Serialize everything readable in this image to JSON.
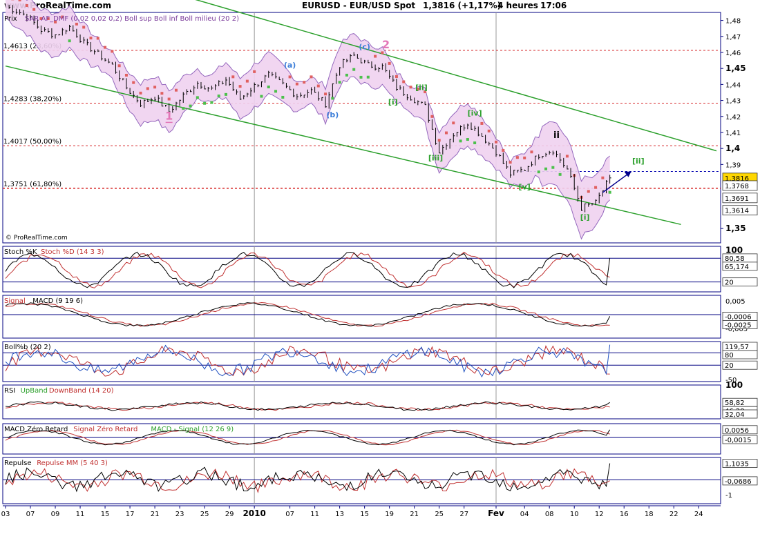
{
  "header": {
    "site": "www.ProRealTime.com",
    "symbol": "EURUSD - EUR/USD Spot",
    "price": "1,3816 (+1,17%)",
    "timeframe": "4 heures",
    "time": "17:06"
  },
  "watermark": "© ProRealTime.com",
  "chart_data": {
    "type": "line",
    "price_panel": {
      "label": "Prix",
      "indicators": "SAR AF_DMF (0,02 0,02 0,2)   Boll sup Boll inf Boll milieu (20 2)",
      "y_ticks": [
        "1,48",
        "1,47",
        "1,46",
        "1,45",
        "1,44",
        "1,43",
        "1,42",
        "1,41",
        "1,4",
        "1,39",
        "1,35"
      ],
      "ylim": [
        1.341,
        1.485
      ],
      "fib_levels": [
        {
          "label": "1,4613 (23,60%)",
          "value": 1.4613
        },
        {
          "label": "1,4283 (38,20%)",
          "value": 1.4283
        },
        {
          "label": "1,4017 (50,00%)",
          "value": 1.4017
        },
        {
          "label": "1,3751 (61,80%)",
          "value": 1.3751
        }
      ],
      "target_line": 1.3856,
      "price_labels": [
        {
          "label": "1,3816",
          "value": 1.3816,
          "bg": "#ffd700"
        },
        {
          "label": "1,3768",
          "value": 1.3768,
          "bg": "#ffffff"
        },
        {
          "label": "1,3691",
          "value": 1.3691,
          "bg": "#ffffff"
        },
        {
          "label": "1,3614",
          "value": 1.3614,
          "bg": "#ffffff"
        }
      ],
      "wave_labels": [
        {
          "text": "1",
          "t": 23,
          "v": 1.418,
          "color": "#e377b8",
          "size": 16
        },
        {
          "text": "2",
          "t": 53.5,
          "v": 1.4625,
          "color": "#e377b8",
          "size": 16
        },
        {
          "text": "(a)",
          "t": 40,
          "v": 1.4505,
          "color": "#3b7dd8",
          "size": 11
        },
        {
          "text": "(b)",
          "t": 46,
          "v": 1.4195,
          "color": "#3b7dd8",
          "size": 11
        },
        {
          "text": "(c)",
          "t": 50.5,
          "v": 1.462,
          "color": "#3b7dd8",
          "size": 11
        },
        {
          "text": "[i]",
          "t": 54.5,
          "v": 1.4275,
          "color": "#2ca02c",
          "size": 11
        },
        {
          "text": "[ii]",
          "t": 58.5,
          "v": 1.4365,
          "color": "#2ca02c",
          "size": 11
        },
        {
          "text": "[iii]",
          "t": 60.5,
          "v": 1.3925,
          "color": "#2ca02c",
          "size": 11
        },
        {
          "text": "[iv]",
          "t": 66,
          "v": 1.4205,
          "color": "#2ca02c",
          "size": 11
        },
        {
          "text": "[v]",
          "t": 73,
          "v": 1.3745,
          "color": "#2ca02c",
          "size": 11
        },
        {
          "text": "ii",
          "t": 77.5,
          "v": 1.4065,
          "color": "#000000",
          "size": 13
        },
        {
          "text": "[i]",
          "t": 81.5,
          "v": 1.3555,
          "color": "#2ca02c",
          "size": 11
        },
        {
          "text": "[ii]",
          "t": 89,
          "v": 1.3905,
          "color": "#2ca02c",
          "size": 11
        }
      ],
      "channel_upper": [
        [
          0,
          1.5275
        ],
        [
          100,
          1.3985
        ]
      ],
      "channel_lower": [
        [
          0,
          1.4515
        ],
        [
          95,
          1.3525
        ]
      ],
      "arrow": [
        [
          84,
          1.3725
        ],
        [
          88,
          1.3855
        ]
      ],
      "series": [
        {
          "name": "Close",
          "t": [
            0,
            3,
            5,
            7,
            9,
            11,
            13,
            15,
            17,
            19,
            21,
            23,
            25,
            27,
            29,
            31,
            33,
            35,
            37,
            39,
            41,
            43,
            45,
            47,
            49,
            51,
            53,
            55,
            57,
            59,
            61,
            63,
            65,
            67,
            69,
            71,
            73,
            75,
            77,
            79,
            81,
            83,
            85
          ],
          "v": [
            1.489,
            1.483,
            1.474,
            1.471,
            1.476,
            1.466,
            1.459,
            1.452,
            1.438,
            1.428,
            1.432,
            1.423,
            1.433,
            1.441,
            1.437,
            1.443,
            1.431,
            1.439,
            1.446,
            1.44,
            1.433,
            1.436,
            1.428,
            1.452,
            1.458,
            1.452,
            1.451,
            1.438,
            1.432,
            1.426,
            1.398,
            1.409,
            1.416,
            1.408,
            1.398,
            1.384,
            1.387,
            1.396,
            1.399,
            1.387,
            1.363,
            1.366,
            1.3816
          ]
        }
      ]
    },
    "panels": [
      {
        "key": "stoch",
        "label_parts": [
          {
            "text": "Stoch %K ",
            "color": "#000000"
          },
          {
            "text": "Stoch %D (14 3 3)",
            "color": "#c03030"
          }
        ],
        "y_ticks": [
          "100",
          "20"
        ],
        "boxes": [
          {
            "label": "80,58",
            "v": 80.58
          },
          {
            "label": "65,174",
            "v": 65.17
          },
          {
            "label": "20",
            "v": 20
          }
        ],
        "hlines": [
          {
            "v": 80,
            "color": "#000080"
          },
          {
            "v": 20,
            "color": "#000080"
          }
        ],
        "ylim": [
          -5,
          110
        ]
      },
      {
        "key": "macd",
        "label_parts": [
          {
            "text": "Signal ",
            "color": "#c03030"
          },
          {
            "text": "MACD (9 19 6)",
            "color": "#000000"
          }
        ],
        "y_ticks": [
          "0,005",
          "-0,005"
        ],
        "boxes": [
          {
            "label": "-0,0006",
            "v": -0.0006
          },
          {
            "label": "-0,0025",
            "v": -0.0025
          }
        ],
        "hlines": [
          {
            "v": 0,
            "color": "#000080"
          }
        ],
        "ylim": [
          -0.0085,
          0.007
        ]
      },
      {
        "key": "boll",
        "label_parts": [
          {
            "text": "Boll%b (20 2)",
            "color": "#000000"
          }
        ],
        "y_ticks": [
          "80",
          "20",
          "-50"
        ],
        "boxes": [
          {
            "label": "119,57",
            "v": 119.57
          },
          {
            "label": "80",
            "v": 80
          },
          {
            "label": "20",
            "v": 20
          }
        ],
        "hlines": [
          {
            "v": 80,
            "color": "#000080"
          },
          {
            "v": 20,
            "color": "#000080"
          }
        ],
        "ylim": [
          -60,
          135
        ]
      },
      {
        "key": "rsi",
        "label_parts": [
          {
            "text": "RSI ",
            "color": "#000000"
          },
          {
            "text": "UpBand ",
            "color": "#2ca02c"
          },
          {
            "text": "DownBand (14 20)",
            "color": "#c03030"
          }
        ],
        "y_ticks": [
          "100"
        ],
        "boxes": [
          {
            "label": "58,82",
            "v": 58.82
          },
          {
            "label": "46,28",
            "v": 46.28
          },
          {
            "label": "32,04",
            "v": 32.04
          }
        ],
        "hlines": [],
        "ylim": [
          20,
          100
        ]
      },
      {
        "key": "macdzr",
        "label_parts": [
          {
            "text": "MACD Zéro Retard ",
            "color": "#000000"
          },
          {
            "text": "Signal Zéro Retard ",
            "color": "#c03030"
          },
          {
            "text": "MACD - Signal (12 26 9)",
            "color": "#2ca02c"
          }
        ],
        "y_ticks": [],
        "boxes": [
          {
            "label": "0,0056",
            "v": 0.0056
          },
          {
            "label": "-0,0015",
            "v": -0.0015
          }
        ],
        "hlines": [
          {
            "v": 0,
            "color": "#000080"
          }
        ],
        "ylim": [
          -0.012,
          0.01
        ]
      },
      {
        "key": "repulse",
        "label_parts": [
          {
            "text": "Repulse ",
            "color": "#000000"
          },
          {
            "text": "Repulse MM (5 40 3)",
            "color": "#c03030"
          }
        ],
        "y_ticks": [
          "1",
          "-1"
        ],
        "boxes": [
          {
            "label": "1,1035",
            "v": 1.1035
          },
          {
            "label": "-0,0686",
            "v": -0.0686
          }
        ],
        "hlines": [
          {
            "v": 0,
            "color": "#000080"
          }
        ],
        "ylim": [
          -1.6,
          1.5
        ]
      }
    ],
    "x_tick_labels": [
      {
        "t": 0,
        "label": "03"
      },
      {
        "t": 3.5,
        "label": "07"
      },
      {
        "t": 7,
        "label": "09"
      },
      {
        "t": 10.5,
        "label": "11"
      },
      {
        "t": 14,
        "label": "15"
      },
      {
        "t": 17.5,
        "label": "17"
      },
      {
        "t": 21,
        "label": "21"
      },
      {
        "t": 24.5,
        "label": "23"
      },
      {
        "t": 28,
        "label": "25"
      },
      {
        "t": 31.5,
        "label": "29"
      },
      {
        "t": 35,
        "label": "2010",
        "bold": true
      },
      {
        "t": 40,
        "label": "07"
      },
      {
        "t": 43.5,
        "label": "11"
      },
      {
        "t": 47,
        "label": "13"
      },
      {
        "t": 50.5,
        "label": "15"
      },
      {
        "t": 54,
        "label": "19"
      },
      {
        "t": 57.5,
        "label": "21"
      },
      {
        "t": 61,
        "label": "25"
      },
      {
        "t": 64.5,
        "label": "27"
      },
      {
        "t": 69,
        "label": "Fev",
        "bold": true
      },
      {
        "t": 73,
        "label": "04"
      },
      {
        "t": 76.5,
        "label": "08"
      },
      {
        "t": 80,
        "label": "10"
      },
      {
        "t": 83.5,
        "label": "12"
      },
      {
        "t": 87,
        "label": "16"
      },
      {
        "t": 90.5,
        "label": "18"
      },
      {
        "t": 94,
        "label": "22"
      },
      {
        "t": 97.5,
        "label": "24"
      }
    ],
    "x_tick_positions": [],
    "grid": true
  },
  "colors": {
    "channel": "#2ca02c",
    "fib": "#d62728",
    "band_fill": "#f0d2f0",
    "band_line": "#9467bd",
    "sar_red": "#e06060",
    "sar_green": "#4cc04c",
    "axis": "#000080"
  }
}
